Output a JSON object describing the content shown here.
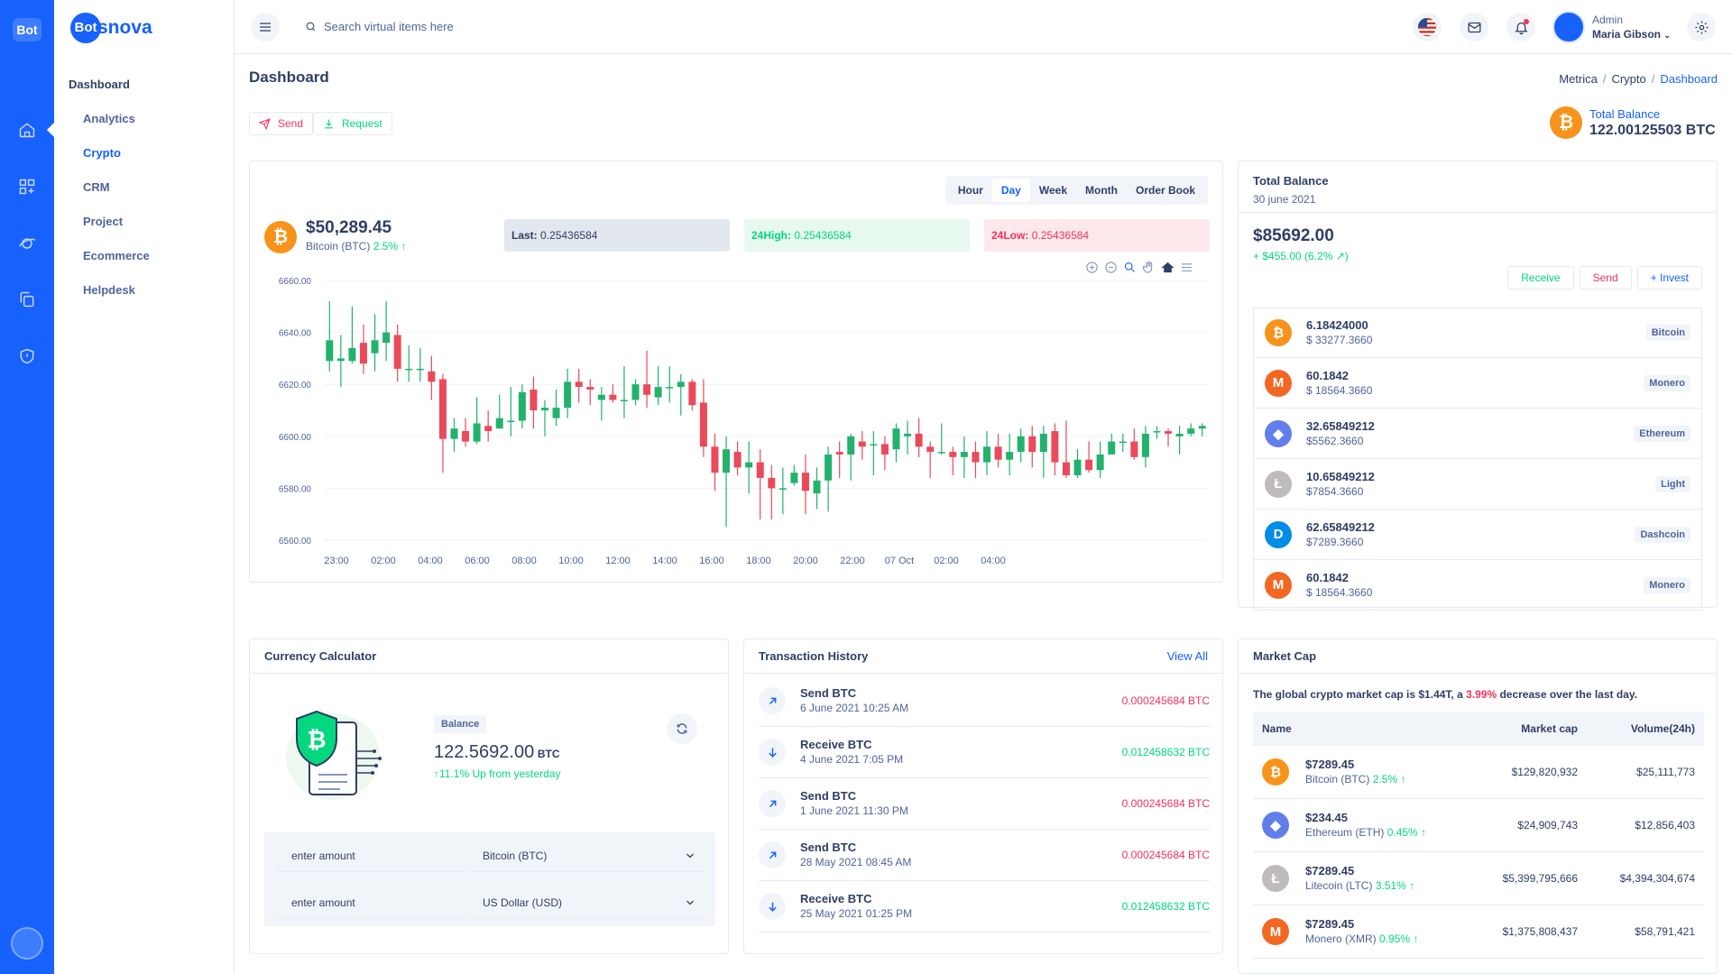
{
  "rail": {
    "logo_text": "Bot"
  },
  "brand": {
    "circle_text": "Bot",
    "rest_text": "snova"
  },
  "menu": {
    "title": "Dashboard",
    "items": [
      "Analytics",
      "Crypto",
      "CRM",
      "Project",
      "Ecommerce",
      "Helpdesk"
    ],
    "active": "Crypto"
  },
  "topbar": {
    "search_placeholder": "Search virtual items here",
    "user_role": "Admin",
    "user_name": "Maria Gibson"
  },
  "page": {
    "title": "Dashboard",
    "breadcrumb": [
      "Metrica",
      "Crypto",
      "Dashboard"
    ],
    "send_label": "Send",
    "request_label": "Request",
    "total_balance_label": "Total Balance",
    "total_balance_value": "122.00125503 BTC"
  },
  "chart_card": {
    "tabs": [
      "Hour",
      "Day",
      "Week",
      "Month",
      "Order Book"
    ],
    "active_tab": "Day",
    "price": "$50,289.45",
    "coin_name": "Bitcoin (BTC)",
    "change": "2.5%",
    "last_label": "Last:",
    "last_value": "0.25436584",
    "high_label": "24High:",
    "high_value": "0.25436584",
    "low_label": "24Low:",
    "low_value": "0.25436584"
  },
  "chart_data": {
    "type": "candlestick",
    "ylim": [
      6560,
      6660
    ],
    "y_ticks": [
      "6660.00",
      "6640.00",
      "6620.00",
      "6600.00",
      "6580.00",
      "6560.00"
    ],
    "x_ticks": [
      "23:00",
      "02:00",
      "04:00",
      "06:00",
      "08:00",
      "10:00",
      "12:00",
      "14:00",
      "16:00",
      "18:00",
      "20:00",
      "22:00",
      "07 Oct",
      "02:00",
      "04:00"
    ],
    "grid": true,
    "candles": [
      [
        6629,
        6637,
        6625,
        6652
      ],
      [
        6629,
        6630,
        6619,
        6639
      ],
      [
        6629,
        6634,
        6628,
        6650
      ],
      [
        6636,
        6628,
        6624,
        6643
      ],
      [
        6632,
        6637,
        6625,
        6647
      ],
      [
        6636,
        6640,
        6629,
        6652
      ],
      [
        6639,
        6626,
        6621,
        6643
      ],
      [
        6626,
        6626,
        6621,
        6635
      ],
      [
        6626,
        6626,
        6621,
        6634
      ],
      [
        6625,
        6621,
        6614,
        6631
      ],
      [
        6622,
        6599,
        6586,
        6624
      ],
      [
        6599,
        6603,
        6594,
        6607
      ],
      [
        6602,
        6598,
        6596,
        6607
      ],
      [
        6598,
        6605,
        6597,
        6615
      ],
      [
        6604,
        6602,
        6598,
        6610
      ],
      [
        6603,
        6607,
        6603,
        6616
      ],
      [
        6606,
        6606,
        6600,
        6619
      ],
      [
        6606,
        6617,
        6603,
        6620
      ],
      [
        6618,
        6610,
        6603,
        6623
      ],
      [
        6610,
        6611,
        6600,
        6614
      ],
      [
        6607,
        6611,
        6604,
        6618
      ],
      [
        6611,
        6621,
        6607,
        6626
      ],
      [
        6621,
        6619,
        6613,
        6626
      ],
      [
        6619,
        6618,
        6612,
        6622
      ],
      [
        6614,
        6616,
        6606,
        6619
      ],
      [
        6616,
        6614,
        6613,
        6620
      ],
      [
        6614,
        6614,
        6607,
        6627
      ],
      [
        6614,
        6620,
        6612,
        6622
      ],
      [
        6620,
        6616,
        6611,
        6633
      ],
      [
        6615,
        6619,
        6612,
        6627
      ],
      [
        6619,
        6619,
        6613,
        6627
      ],
      [
        6619,
        6621,
        6608,
        6624
      ],
      [
        6621,
        6612,
        6610,
        6622
      ],
      [
        6613,
        6596,
        6592,
        6622
      ],
      [
        6596,
        6586,
        6579,
        6601
      ],
      [
        6586,
        6595,
        6565,
        6600
      ],
      [
        6594,
        6588,
        6585,
        6598
      ],
      [
        6588,
        6590,
        6578,
        6598
      ],
      [
        6590,
        6584,
        6568,
        6595
      ],
      [
        6584,
        6580,
        6568,
        6589
      ],
      [
        6580,
        6580,
        6570,
        6588
      ],
      [
        6582,
        6586,
        6581,
        6589
      ],
      [
        6586,
        6579,
        6570,
        6593
      ],
      [
        6578,
        6583,
        6572,
        6588
      ],
      [
        6583,
        6593,
        6571,
        6596
      ],
      [
        6594,
        6593,
        6584,
        6598
      ],
      [
        6593,
        6600,
        6583,
        6601
      ],
      [
        6598,
        6596,
        6591,
        6602
      ],
      [
        6597,
        6597,
        6585,
        6602
      ],
      [
        6597,
        6593,
        6587,
        6600
      ],
      [
        6595,
        6603,
        6590,
        6605
      ],
      [
        6600,
        6601,
        6593,
        6606
      ],
      [
        6601,
        6596,
        6592,
        6607
      ],
      [
        6596,
        6594,
        6584,
        6598
      ],
      [
        6594,
        6594,
        6593,
        6605
      ],
      [
        6594,
        6592,
        6585,
        6596
      ],
      [
        6592,
        6594,
        6584,
        6600
      ],
      [
        6594,
        6590,
        6584,
        6598
      ],
      [
        6590,
        6596,
        6585,
        6602
      ],
      [
        6596,
        6591,
        6588,
        6601
      ],
      [
        6591,
        6594,
        6585,
        6601
      ],
      [
        6594,
        6600,
        6590,
        6603
      ],
      [
        6600,
        6594,
        6588,
        6604
      ],
      [
        6594,
        6601,
        6584,
        6604
      ],
      [
        6602,
        6590,
        6585,
        6605
      ],
      [
        6590,
        6585,
        6584,
        6606
      ],
      [
        6585,
        6591,
        6584,
        6595
      ],
      [
        6591,
        6587,
        6586,
        6598
      ],
      [
        6587,
        6593,
        6584,
        6598
      ],
      [
        6593,
        6598,
        6593,
        6601
      ],
      [
        6598,
        6598,
        6594,
        6601
      ],
      [
        6598,
        6592,
        6591,
        6603
      ],
      [
        6592,
        6601,
        6588,
        6604
      ],
      [
        6602,
        6602,
        6599,
        6604
      ],
      [
        6602,
        6601,
        6596,
        6603
      ],
      [
        6600,
        6601,
        6593,
        6604
      ],
      [
        6601,
        6603,
        6600,
        6605
      ],
      [
        6603,
        6604,
        6600,
        6605
      ]
    ]
  },
  "balance_card": {
    "title": "Total Balance",
    "date": "30 june 2021",
    "amount": "$85692.00",
    "change": "+ $455.00 (6.2% ↗)",
    "receive": "Receive",
    "send": "Send",
    "invest": "+ Invest",
    "assets": [
      {
        "amount": "6.18424000",
        "usd": "$ 33277.3660",
        "tag": "Bitcoin",
        "icon": "bitcoin-icon",
        "color": "#f7931a"
      },
      {
        "amount": "60.1842",
        "usd": "$ 18564.3660",
        "tag": "Monero",
        "icon": "monero-icon",
        "color": "#f26822"
      },
      {
        "amount": "32.65849212",
        "usd": "$5562.3660",
        "tag": "Ethereum",
        "icon": "ethereum-icon",
        "color": "#627eea"
      },
      {
        "amount": "10.65849212",
        "usd": "$7854.3660",
        "tag": "Light",
        "icon": "litecoin-icon",
        "color": "#bfbbbb"
      },
      {
        "amount": "62.65849212",
        "usd": "$7289.3660",
        "tag": "Dashcoin",
        "icon": "dash-icon",
        "color": "#008ce7"
      },
      {
        "amount": "60.1842",
        "usd": "$ 18564.3660",
        "tag": "Monero",
        "icon": "monero-icon",
        "color": "#f26822"
      }
    ]
  },
  "calculator": {
    "title": "Currency Calculator",
    "balance_label": "Balance",
    "amount": "122.5692.00",
    "unit": "BTC",
    "change": "11.1% Up from yesterday",
    "rows": [
      {
        "placeholder": "enter amount",
        "currency": "Bitcoin (BTC)"
      },
      {
        "placeholder": "enter amount",
        "currency": "US Dollar (USD)"
      }
    ]
  },
  "transactions": {
    "title": "Transaction History",
    "view_all": "View All",
    "items": [
      {
        "label": "Send BTC",
        "date": "6 June 2021 10:25 AM",
        "amount": "0.000245684 BTC",
        "kind": "send"
      },
      {
        "label": "Receive BTC",
        "date": "4 June 2021 7:05 PM",
        "amount": "0.012458632 BTC",
        "kind": "receive"
      },
      {
        "label": "Send BTC",
        "date": "1 June 2021 11:30 PM",
        "amount": "0.000245684 BTC",
        "kind": "send"
      },
      {
        "label": "Send BTC",
        "date": "28 May 2021 08:45 AM",
        "amount": "0.000245684 BTC",
        "kind": "send"
      },
      {
        "label": "Receive BTC",
        "date": "25 May 2021 01:25 PM",
        "amount": "0.012458632 BTC",
        "kind": "receive"
      }
    ]
  },
  "market_cap": {
    "title": "Market Cap",
    "summary_prefix": "The global crypto market cap is $1.44T, a ",
    "summary_pct": "3.99%",
    "summary_suffix": " decrease over the last day.",
    "columns": [
      "Name",
      "Market cap",
      "Volume(24h)"
    ],
    "rows": [
      {
        "price": "$7289.45",
        "name": "Bitcoin (BTC)",
        "change": "2.5%",
        "cap": "$129,820,932",
        "volume": "$25,111,773",
        "icon": "bitcoin-icon",
        "color": "#f7931a"
      },
      {
        "price": "$234.45",
        "name": "Ethereum (ETH)",
        "change": "0.45%",
        "cap": "$24,909,743",
        "volume": "$12,856,403",
        "icon": "ethereum-icon",
        "color": "#627eea"
      },
      {
        "price": "$7289.45",
        "name": "Litecoin (LTC)",
        "change": "3.51%",
        "cap": "$5,399,795,666",
        "volume": "$4,394,304,674",
        "icon": "litecoin-icon",
        "color": "#bfbbbb"
      },
      {
        "price": "$7289.45",
        "name": "Monero (XMR)",
        "change": "0.95%",
        "cap": "$1,375,808,437",
        "volume": "$58,791,421",
        "icon": "monero-icon",
        "color": "#f26822"
      }
    ]
  }
}
